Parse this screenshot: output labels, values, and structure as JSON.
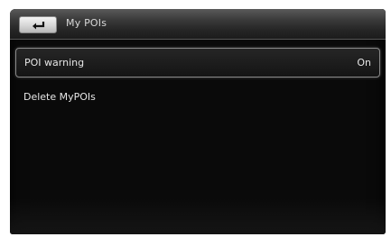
{
  "header": {
    "title": "My POIs",
    "back_icon": "return-arrow-icon"
  },
  "menu": {
    "items": [
      {
        "label": "POI warning",
        "value": "On"
      },
      {
        "label": "Delete MyPOIs"
      }
    ]
  },
  "colors": {
    "screen_background": "#0a0a0a",
    "text": "#e6e6e6",
    "selection_border": "#8a8a8a"
  }
}
